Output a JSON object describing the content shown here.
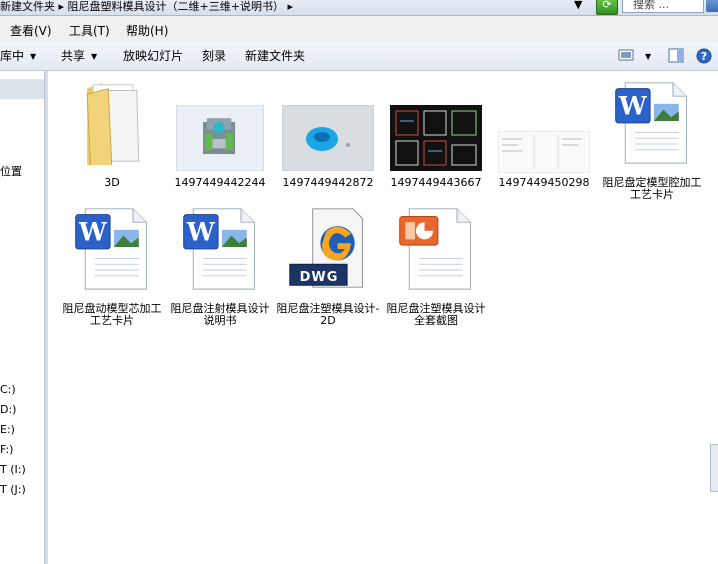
{
  "address": {
    "path": "新建文件夹 ▸ 阻尼盘塑料模具设计（二维+三维+说明书） ▸",
    "search_placeholder": "搜索 ..."
  },
  "menu": {
    "items": [
      "查看(V)",
      "工具(T)",
      "帮助(H)"
    ]
  },
  "toolbar": {
    "include_library": "库中",
    "share": "共享",
    "slideshow": "放映幻灯片",
    "burn": "刻录",
    "new_folder": "新建文件夹"
  },
  "navpane": {
    "location_label": "位置",
    "drives": [
      "C:)",
      "D:)",
      "E:)",
      "F:)",
      "T (I:)",
      "T (J:)"
    ]
  },
  "files": [
    {
      "name": "3D",
      "type": "folder"
    },
    {
      "name": "1497449442244",
      "type": "image-3d-mold"
    },
    {
      "name": "1497449442872",
      "type": "image-blue-part"
    },
    {
      "name": "1497449443667",
      "type": "image-cad-drawing"
    },
    {
      "name": "1497449450298",
      "type": "image-document"
    },
    {
      "name": "阻尼盘定模型腔加工工艺卡片",
      "type": "word"
    },
    {
      "name": "阻尼盘动模型芯加工工艺卡片",
      "type": "word"
    },
    {
      "name": "阻尼盘注射模具设计说明书",
      "type": "word"
    },
    {
      "name": "阻尼盘注塑模具设计-2D",
      "type": "dwg",
      "badge": "DWG"
    },
    {
      "name": "阻尼盘注塑模具设计全套截图",
      "type": "powerpoint"
    }
  ]
}
